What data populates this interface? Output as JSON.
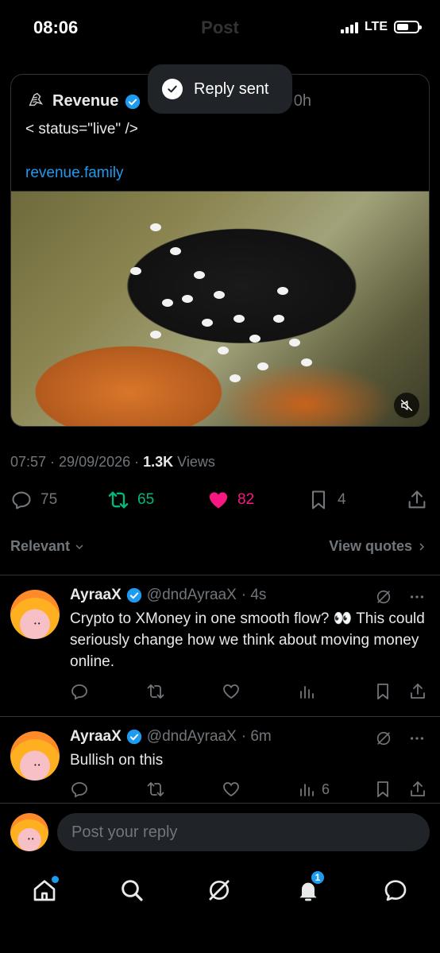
{
  "status_bar": {
    "time": "08:06",
    "network": "LTE"
  },
  "header": {
    "title": "Post"
  },
  "toast": {
    "text": "Reply sent"
  },
  "quoted_post": {
    "name": "Revenue",
    "time_suffix": "0h",
    "body": "< status=\"live\" />",
    "link": "revenue.family"
  },
  "post_meta": {
    "time_date": "07:57 · 29/09/2026 · ",
    "views_count": "1.3K",
    "views_label": " Views"
  },
  "actions": {
    "replies": "75",
    "reposts": "65",
    "likes": "82",
    "bookmarks": "4"
  },
  "colors": {
    "accent": "#1d9bf0",
    "repost": "#00ba7c",
    "like": "#f91880",
    "muted": "#71767b"
  },
  "sort": {
    "relevant": "Relevant",
    "view_quotes": "View quotes"
  },
  "replies": [
    {
      "name": "AyraaX",
      "handle": "@dndAyraaX",
      "time": "· 4s",
      "text": "Crypto to XMoney in one smooth flow? 👀 This could seriously change how we think about moving money online.",
      "views": ""
    },
    {
      "name": "AyraaX",
      "handle": "@dndAyraaX",
      "time": "· 6m",
      "text": "Bullish on this",
      "views": "6"
    }
  ],
  "compose": {
    "placeholder": "Post your reply"
  },
  "tabbar": {
    "notifications_badge": "1"
  }
}
